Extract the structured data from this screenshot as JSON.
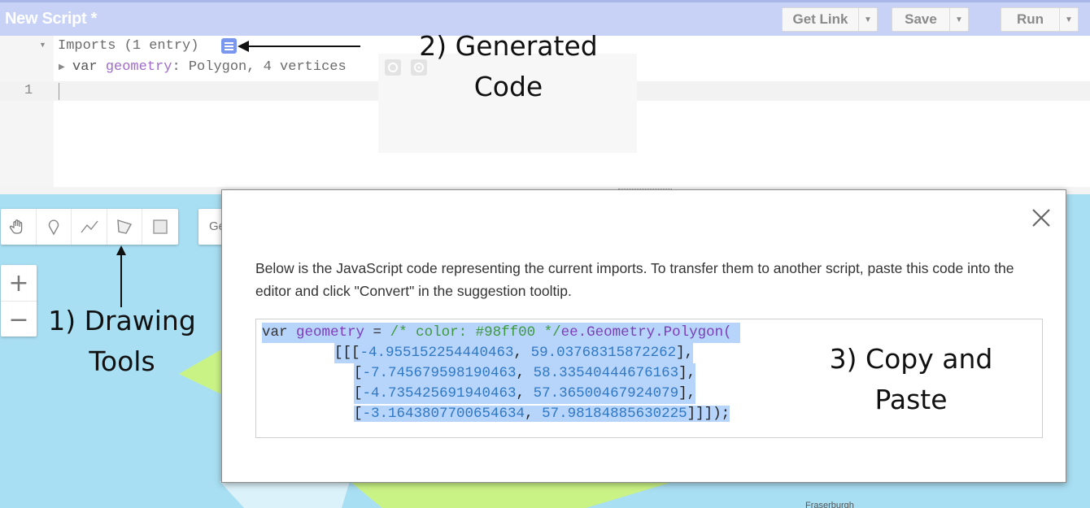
{
  "header": {
    "script_title": "New Script *",
    "get_link": "Get Link",
    "save": "Save",
    "run": "Run"
  },
  "editor": {
    "imports_line": "Imports (1 entry)",
    "var_keyword": "var",
    "var_name": "geometry",
    "var_desc": ": Polygon, 4 vertices",
    "line_number": "1"
  },
  "annotations": {
    "generated_code_1": "2) Generated",
    "generated_code_2": "Code",
    "drawing_tools_1": "1) Drawing",
    "drawing_tools_2": "Tools",
    "copy_paste_1": "3) Copy and",
    "copy_paste_2": "Paste"
  },
  "map": {
    "search_placeholder": "Ge",
    "zoom_in": "+",
    "zoom_out": "−",
    "town_label": "Fraserburgh"
  },
  "dialog": {
    "message": "Below is the JavaScript code representing the current imports. To transfer them to another script, paste this code into the editor and click \"Convert\" in the suggestion tooltip.",
    "code": {
      "var_kw": "var",
      "var_name": "geometry",
      "eq": " = ",
      "comment": "/* color: #98ff00 */",
      "ctor": "ee.Geometry.Polygon(",
      "coords": [
        [
          "-4.955152254440463",
          "59.03768315872262"
        ],
        [
          "-7.745679598190463",
          "58.33540444676163"
        ],
        [
          "-4.735425691940463",
          "57.36500467924079"
        ],
        [
          "-3.1643807700654634",
          "57.98184885630225"
        ]
      ],
      "close": "]]]);"
    }
  },
  "colors": {
    "title_bar": "#c7d2f6",
    "map_water": "#a9dff3",
    "polygon_fill": "#cdf57a",
    "selection": "#b7d4fb",
    "keyword_purple": "#7b3db8",
    "comment_green": "#3c9a3c",
    "number_blue": "#2f78c4"
  },
  "icons": [
    "hand-icon",
    "marker-icon",
    "line-icon",
    "polygon-icon",
    "rectangle-icon",
    "document-icon",
    "close-icon",
    "gear-icon",
    "target-icon"
  ]
}
